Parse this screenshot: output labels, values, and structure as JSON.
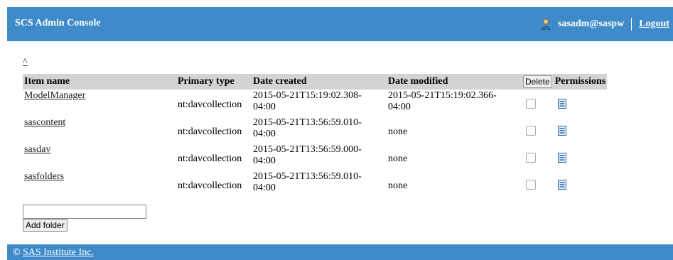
{
  "header": {
    "title": "SCS Admin Console",
    "user": "sasadm@saspw",
    "logout_label": "Logout"
  },
  "nav": {
    "up_label": "^"
  },
  "table": {
    "columns": [
      "Item name",
      "Primary type",
      "Date created",
      "Date modified",
      "Delete",
      "Permissions"
    ],
    "rows": [
      {
        "name": "ModelManager",
        "type": "nt:davcollection",
        "created_a": "2015-05-21T15:19:02.308-",
        "created_b": "04:00",
        "modified_a": "2015-05-21T15:19:02.366-",
        "modified_b": "04:00"
      },
      {
        "name": "sascontent",
        "type": "nt:davcollection",
        "created_a": "2015-05-21T13:56:59.010-",
        "created_b": "04:00",
        "modified": "none"
      },
      {
        "name": "sasdav",
        "type": "nt:davcollection",
        "created_a": "2015-05-21T13:56:59.000-",
        "created_b": "04:00",
        "modified": "none"
      },
      {
        "name": "sasfolders",
        "type": "nt:davcollection",
        "created_a": "2015-05-21T13:56:59.010-",
        "created_b": "04:00",
        "modified": "none"
      }
    ]
  },
  "form": {
    "folder_value": "",
    "add_folder_label": "Add folder"
  },
  "footer": {
    "copyright": "©",
    "company": "SAS Institute Inc."
  },
  "colors": {
    "header_bg": "#3f8bc9",
    "table_header_bg": "#d3d3d3"
  },
  "icons": {
    "user": "user-icon",
    "permissions": "permissions-icon"
  }
}
